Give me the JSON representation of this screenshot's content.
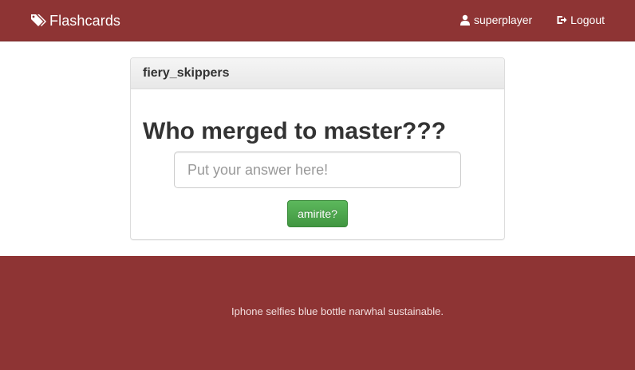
{
  "navbar": {
    "brand": "Flashcards",
    "brand_icon": "tags-icon",
    "user_label": "superplayer",
    "user_icon": "user-icon",
    "logout_label": "Logout",
    "logout_icon": "logout-icon",
    "background_color": "#8e3434"
  },
  "card": {
    "deck_title": "fiery_skippers",
    "question": "Who merged to master???",
    "answer_placeholder": "Put your answer here!",
    "answer_value": "",
    "submit_label": "amirite?",
    "submit_color": "#5cb85c"
  },
  "footer": {
    "text": "Iphone selfies blue bottle narwhal sustainable.",
    "background_color": "#8e3434"
  }
}
